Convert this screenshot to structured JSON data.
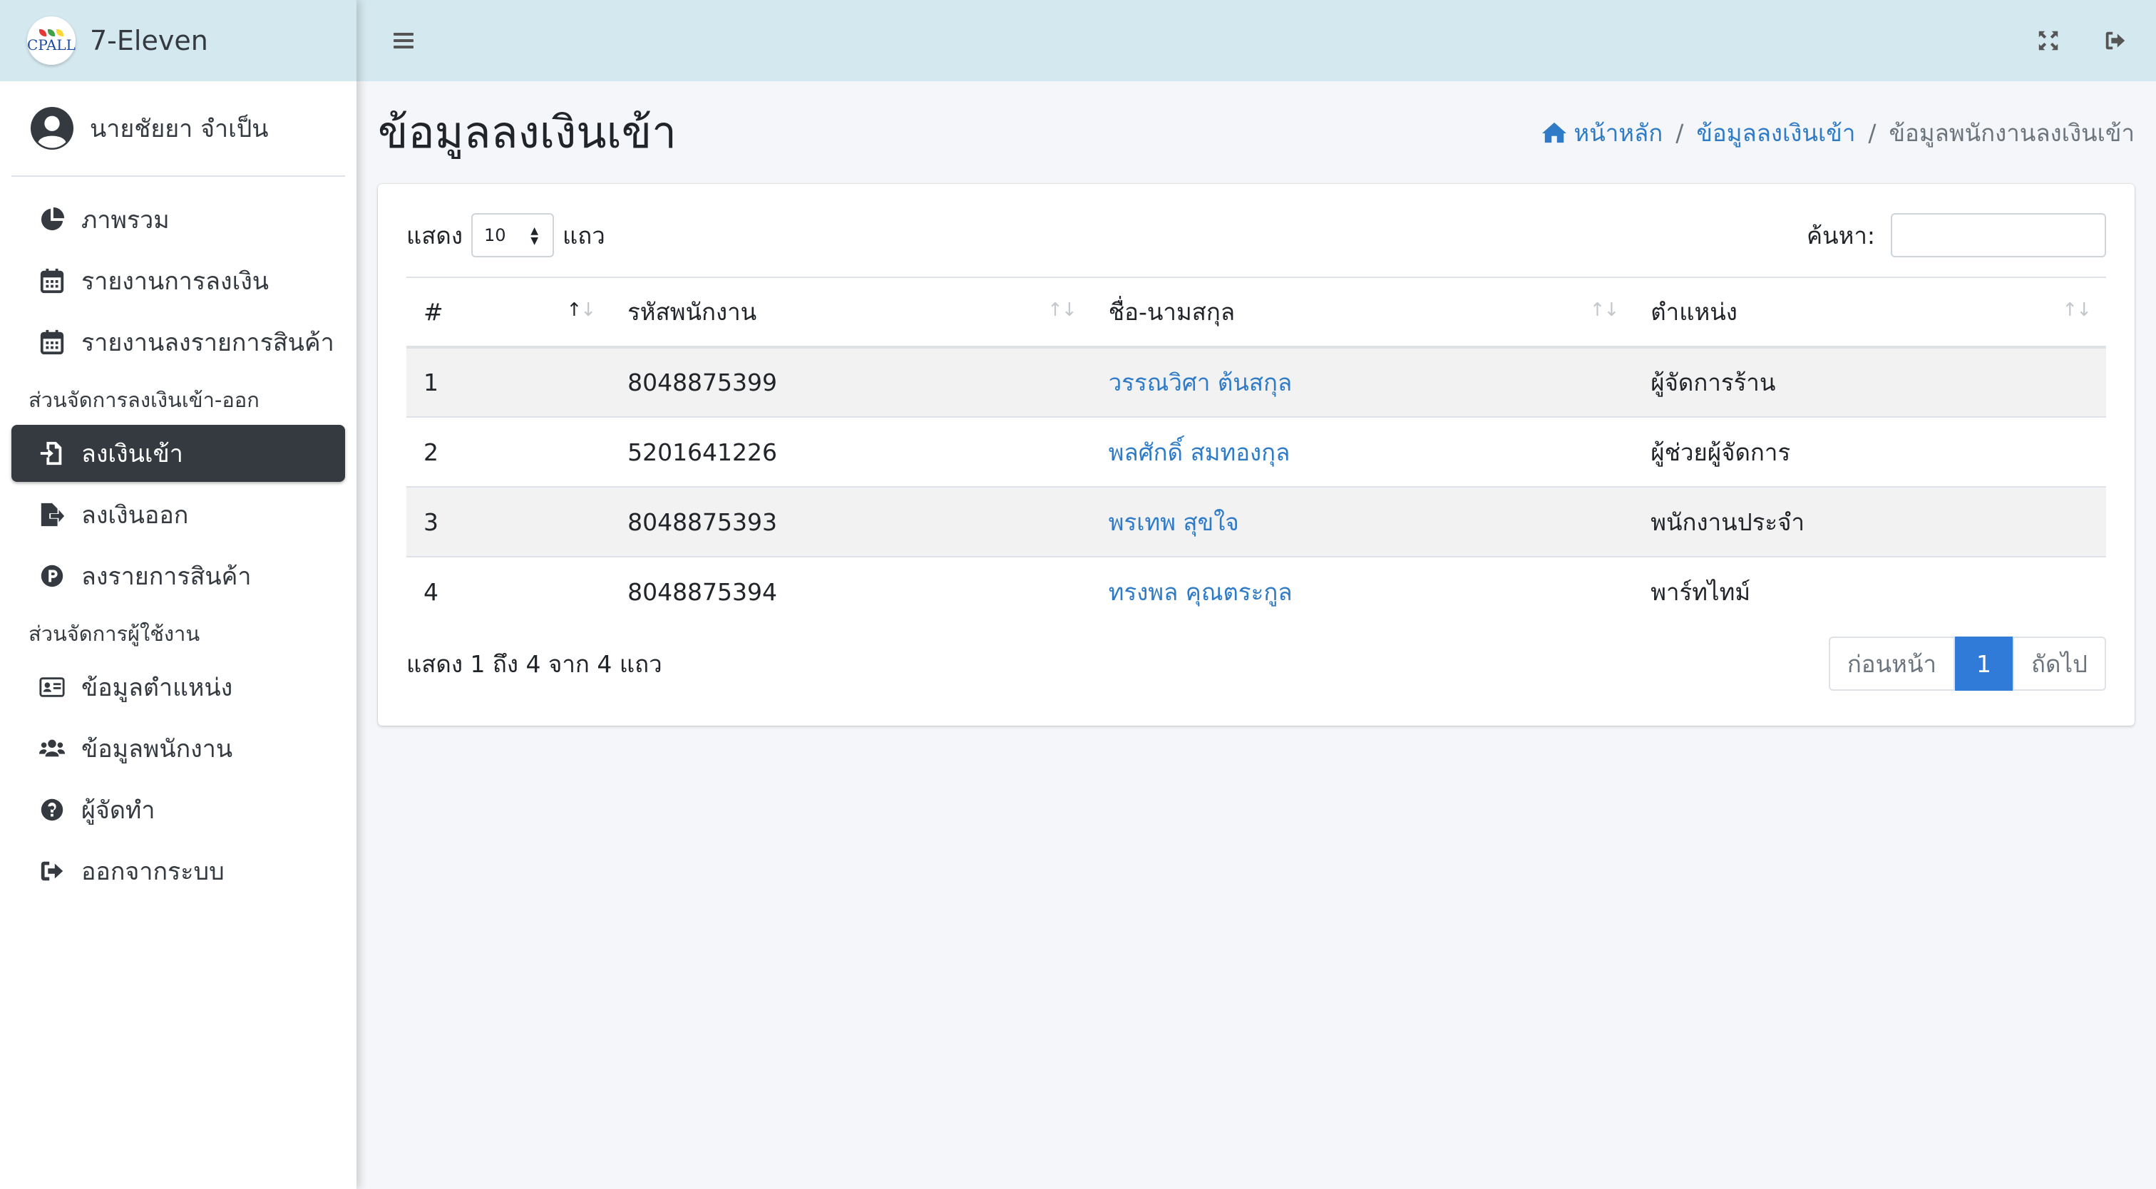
{
  "brand": {
    "logo_text": "CPALL",
    "name": "7-Eleven"
  },
  "user": {
    "name": "นายชัยยา จำเป็น"
  },
  "sidebar": {
    "items": [
      {
        "label": "ภาพรวม",
        "icon": "pie-chart-icon"
      },
      {
        "label": "รายงานการลงเงิน",
        "icon": "calendar-icon"
      },
      {
        "label": "รายงานลงรายการสินค้า",
        "icon": "calendar-icon"
      }
    ],
    "section_money": "ส่วนจัดการลงเงินเข้า-ออก",
    "money_items": [
      {
        "label": "ลงเงินเข้า",
        "icon": "file-import-icon",
        "active": true
      },
      {
        "label": "ลงเงินออก",
        "icon": "file-export-icon"
      },
      {
        "label": "ลงรายการสินค้า",
        "icon": "product-p-icon"
      }
    ],
    "section_users": "ส่วนจัดการผู้ใช้งาน",
    "user_items": [
      {
        "label": "ข้อมูลตำแหน่ง",
        "icon": "id-card-icon"
      },
      {
        "label": "ข้อมูลพนักงาน",
        "icon": "users-icon"
      },
      {
        "label": "ผู้จัดทำ",
        "icon": "question-circle-icon"
      },
      {
        "label": "ออกจากระบบ",
        "icon": "sign-out-icon"
      }
    ]
  },
  "header": {
    "title": "ข้อมูลลงเงินเข้า",
    "breadcrumb": {
      "home": "หน้าหลัก",
      "parent": "ข้อมูลลงเงินเข้า",
      "current": "ข้อมูลพนักงานลงเงินเข้า"
    }
  },
  "table_controls": {
    "show_label": "แสดง",
    "length_value": "10",
    "rows_label": "แถว",
    "search_label": "ค้นหา:",
    "search_value": ""
  },
  "table": {
    "columns": [
      "#",
      "รหัสพนักงาน",
      "ชื่อ-นามสกุล",
      "ตำแหน่ง"
    ],
    "rows": [
      {
        "no": "1",
        "emp_id": "8048875399",
        "name": "วรรณวิศา ต้นสกุล",
        "position": "ผู้จัดการร้าน"
      },
      {
        "no": "2",
        "emp_id": "5201641226",
        "name": "พลศักดิ์ สมทองกุล",
        "position": "ผู้ช่วยผู้จัดการ"
      },
      {
        "no": "3",
        "emp_id": "8048875393",
        "name": "พรเทพ สุขใจ",
        "position": "พนักงานประจำ"
      },
      {
        "no": "4",
        "emp_id": "8048875394",
        "name": "ทรงพล คุณตระกูล",
        "position": "พาร์ทไทม์"
      }
    ]
  },
  "footer": {
    "info": "แสดง 1 ถึง 4 จาก 4 แถว",
    "prev": "ก่อนหน้า",
    "page": "1",
    "next": "ถัดไป"
  },
  "colors": {
    "brand_bg": "#d4e8ef",
    "active_nav": "#343a40",
    "link": "#2f7bc7",
    "page_active": "#2f7bd7"
  }
}
